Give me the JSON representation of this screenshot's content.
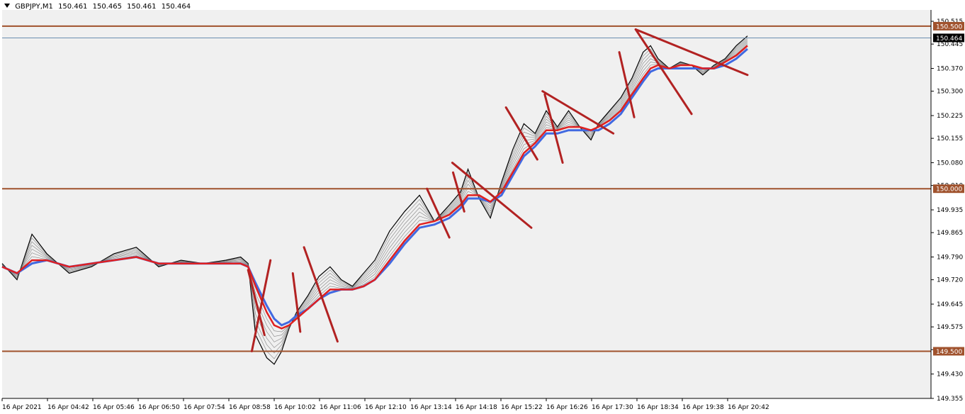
{
  "header": {
    "symbol": "GBPJPY,M1",
    "open": "150.461",
    "high": "150.465",
    "low": "150.461",
    "close": "150.464"
  },
  "colors": {
    "background": "#f0f0f0",
    "level_line": "#a0522d",
    "trend_line": "#b22222",
    "ema_red": "#e02020",
    "ema_blue": "#4169e1",
    "candles": "#000000",
    "bid_line": "#6b8fb0"
  },
  "chart_data": {
    "type": "line",
    "title": "",
    "xlabel": "",
    "ylabel": "",
    "ylim": [
      149.355,
      150.55
    ],
    "y_ticks": [
      "150.515",
      "150.445",
      "150.370",
      "150.300",
      "150.225",
      "150.155",
      "150.080",
      "150.010",
      "149.935",
      "149.865",
      "149.790",
      "149.720",
      "149.645",
      "149.575",
      "149.505",
      "149.430",
      "149.355"
    ],
    "x_ticks": [
      "16 Apr 2021",
      "16 Apr 04:42",
      "16 Apr 05:46",
      "16 Apr 06:50",
      "16 Apr 07:54",
      "16 Apr 08:58",
      "16 Apr 10:02",
      "16 Apr 11:06",
      "16 Apr 12:10",
      "16 Apr 13:14",
      "16 Apr 14:18",
      "16 Apr 15:22",
      "16 Apr 16:26",
      "16 Apr 17:30",
      "16 Apr 18:34",
      "16 Apr 19:38",
      "16 Apr 20:42"
    ],
    "x_index_range": [
      0,
      1000
    ],
    "price_levels": [
      {
        "label": "150.500",
        "value": 150.5
      },
      {
        "label": "150.000",
        "value": 150.0
      },
      {
        "label": "149.500",
        "value": 149.5
      }
    ],
    "current_price": {
      "label": "150.464",
      "value": 150.464
    },
    "price_series": {
      "x": [
        0,
        20,
        40,
        60,
        90,
        120,
        150,
        180,
        210,
        240,
        270,
        300,
        320,
        330,
        340,
        355,
        365,
        375,
        385,
        395,
        410,
        425,
        440,
        455,
        470,
        485,
        500,
        520,
        540,
        560,
        580,
        600,
        615,
        625,
        640,
        655,
        670,
        685,
        700,
        715,
        730,
        745,
        760,
        775,
        790,
        800,
        815,
        830,
        845,
        860,
        870,
        880,
        895,
        910,
        925,
        940,
        955,
        970,
        985,
        1000
      ],
      "y": [
        149.77,
        149.72,
        149.86,
        149.8,
        149.74,
        149.76,
        149.8,
        149.82,
        149.76,
        149.78,
        149.77,
        149.78,
        149.79,
        149.77,
        149.55,
        149.48,
        149.46,
        149.5,
        149.57,
        149.62,
        149.67,
        149.73,
        149.76,
        149.72,
        149.7,
        149.74,
        149.78,
        149.87,
        149.93,
        149.98,
        149.9,
        149.95,
        149.99,
        150.06,
        149.97,
        149.91,
        150.02,
        150.12,
        150.2,
        150.17,
        150.24,
        150.19,
        150.24,
        150.19,
        150.15,
        150.2,
        150.24,
        150.28,
        150.34,
        150.42,
        150.44,
        150.4,
        150.37,
        150.39,
        150.38,
        150.35,
        150.38,
        150.4,
        150.44,
        150.47
      ]
    },
    "series": [
      {
        "values": [
          149.76,
          149.74,
          149.78,
          149.78,
          149.76,
          149.77,
          149.78,
          149.79,
          149.77,
          149.77,
          149.77,
          149.77,
          149.77,
          149.76,
          149.7,
          149.62,
          149.58,
          149.57,
          149.58,
          149.6,
          149.63,
          149.66,
          149.69,
          149.69,
          149.69,
          149.7,
          149.72,
          149.78,
          149.84,
          149.89,
          149.9,
          149.92,
          149.95,
          149.98,
          149.98,
          149.96,
          149.99,
          150.05,
          150.11,
          150.14,
          150.18,
          150.18,
          150.19,
          150.19,
          150.18,
          150.19,
          150.21,
          150.24,
          150.29,
          150.34,
          150.37,
          150.38,
          150.37,
          150.38,
          150.38,
          150.37,
          150.37,
          150.39,
          150.41,
          150.44
        ]
      },
      {
        "values": [
          149.76,
          149.74,
          149.77,
          149.78,
          149.76,
          149.77,
          149.78,
          149.79,
          149.77,
          149.77,
          149.77,
          149.77,
          149.77,
          149.76,
          149.71,
          149.64,
          149.6,
          149.58,
          149.59,
          149.61,
          149.63,
          149.66,
          149.68,
          149.69,
          149.69,
          149.7,
          149.72,
          149.77,
          149.83,
          149.88,
          149.89,
          149.91,
          149.94,
          149.97,
          149.97,
          149.96,
          149.98,
          150.04,
          150.1,
          150.13,
          150.17,
          150.17,
          150.18,
          150.18,
          150.18,
          150.18,
          150.2,
          150.23,
          150.28,
          150.33,
          150.36,
          150.37,
          150.37,
          150.37,
          150.37,
          150.37,
          150.37,
          150.38,
          150.4,
          150.43
        ]
      }
    ],
    "trend_lines": [
      {
        "x1": 335,
        "y1": 149.5,
        "x2": 360,
        "y2": 149.78
      },
      {
        "x1": 330,
        "y1": 149.75,
        "x2": 352,
        "y2": 149.55
      },
      {
        "x1": 405,
        "y1": 149.82,
        "x2": 450,
        "y2": 149.53
      },
      {
        "x1": 390,
        "y1": 149.74,
        "x2": 400,
        "y2": 149.56
      },
      {
        "x1": 570,
        "y1": 150.0,
        "x2": 600,
        "y2": 149.85
      },
      {
        "x1": 604,
        "y1": 150.08,
        "x2": 710,
        "y2": 149.88
      },
      {
        "x1": 605,
        "y1": 150.05,
        "x2": 620,
        "y2": 149.93
      },
      {
        "x1": 676,
        "y1": 150.25,
        "x2": 718,
        "y2": 150.09
      },
      {
        "x1": 725,
        "y1": 150.3,
        "x2": 820,
        "y2": 150.17
      },
      {
        "x1": 728,
        "y1": 150.29,
        "x2": 752,
        "y2": 150.08
      },
      {
        "x1": 828,
        "y1": 150.42,
        "x2": 848,
        "y2": 150.22
      },
      {
        "x1": 850,
        "y1": 150.49,
        "x2": 925,
        "y2": 150.23
      },
      {
        "x1": 850,
        "y1": 150.49,
        "x2": 1000,
        "y2": 150.35
      }
    ]
  }
}
